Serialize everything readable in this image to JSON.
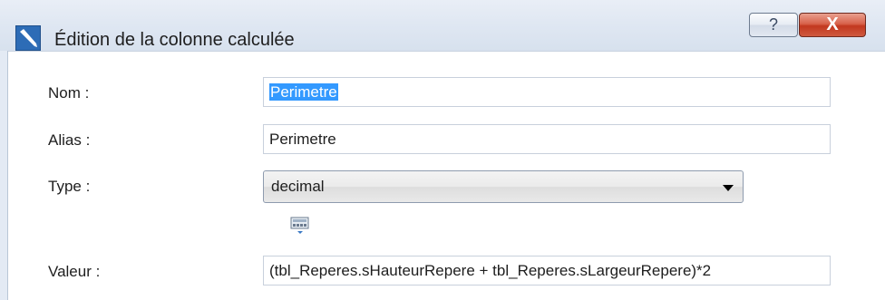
{
  "window": {
    "title": "Édition de la colonne calculée",
    "help_label": "?",
    "close_label": "X"
  },
  "form": {
    "nom_label": "Nom :",
    "nom_value": "Perimetre",
    "alias_label": "Alias :",
    "alias_value": "Perimetre",
    "type_label": "Type :",
    "type_value": "decimal",
    "valeur_label": "Valeur :",
    "valeur_value": "(tbl_Reperes.sHauteurRepere + tbl_Reperes.sLargeurRepere)*2"
  },
  "icons": {
    "app": "edit-pen-icon",
    "expression_editor": "calculator-icon"
  },
  "colors": {
    "selection": "#3399ff",
    "close_button": "#c2381f",
    "app_icon": "#2d6cb6"
  }
}
